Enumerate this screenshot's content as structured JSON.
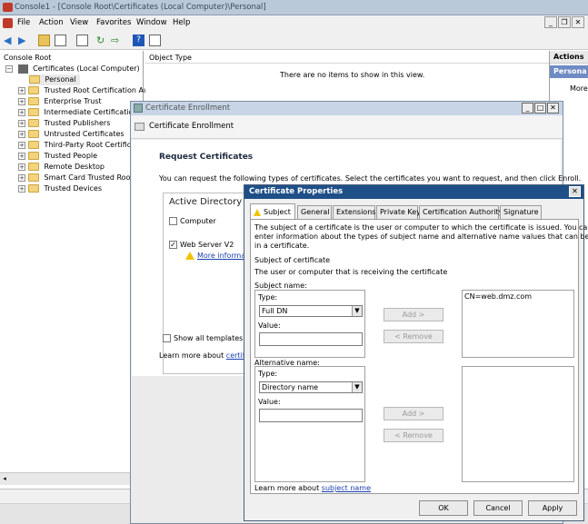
{
  "window": {
    "title": "Console1 - [Console Root\\Certificates (Local Computer)\\Personal]"
  },
  "menu": [
    "File",
    "Action",
    "View",
    "Favorites",
    "Window",
    "Help"
  ],
  "tree": {
    "root": "Console Root",
    "certs": "Certificates (Local Computer)",
    "items": [
      "Personal",
      "Trusted Root Certification Auth",
      "Enterprise Trust",
      "Intermediate Certification A",
      "Trusted Publishers",
      "Untrusted Certificates",
      "Third-Party Root Certificati",
      "Trusted People",
      "Remote Desktop",
      "Smart Card Trusted Roots",
      "Trusted Devices"
    ]
  },
  "center": {
    "column": "Object Type",
    "empty": "There are no items to show in this view."
  },
  "actions": {
    "header": "Actions",
    "selected": "Persona",
    "more": "More"
  },
  "enroll": {
    "title": "Certificate Enrollment",
    "header": "Certificate Enrollment",
    "heading": "Request Certificates",
    "desc": "You can request the following types of certificates. Select the certificates you want to request, and then click Enroll.",
    "policy": "Active Directory",
    "computer": "Computer",
    "webserver": "Web Server V2",
    "more_info": "More informa",
    "show_all": "Show all templates",
    "learn_prefix": "Learn more about ",
    "learn_link": "certifica"
  },
  "props": {
    "title": "Certificate Properties",
    "tabs": [
      "Subject",
      "General",
      "Extensions",
      "Private Key",
      "Certification Authority",
      "Signature"
    ],
    "intro_1": "The subject of a certificate is the user or computer to which the certificate is issued. You can",
    "intro_2": "enter information about the types of subject name and alternative name values that can be used",
    "intro_3": "in a certificate.",
    "subject_of_cert": "Subject of certificate",
    "subject_desc": "The user or computer that is receiving the certificate",
    "subject_name": "Subject name:",
    "type_label": "Type:",
    "subject_type": "Full DN",
    "value_label": "Value:",
    "add": "Add >",
    "remove": "< Remove",
    "subject_value": "CN=web.dmz.com",
    "alt_name": "Alternative name:",
    "alt_type": "Directory name",
    "learn_prefix": "Learn more about ",
    "learn_link": "subject name",
    "ok": "OK",
    "cancel": "Cancel",
    "apply": "Apply"
  }
}
